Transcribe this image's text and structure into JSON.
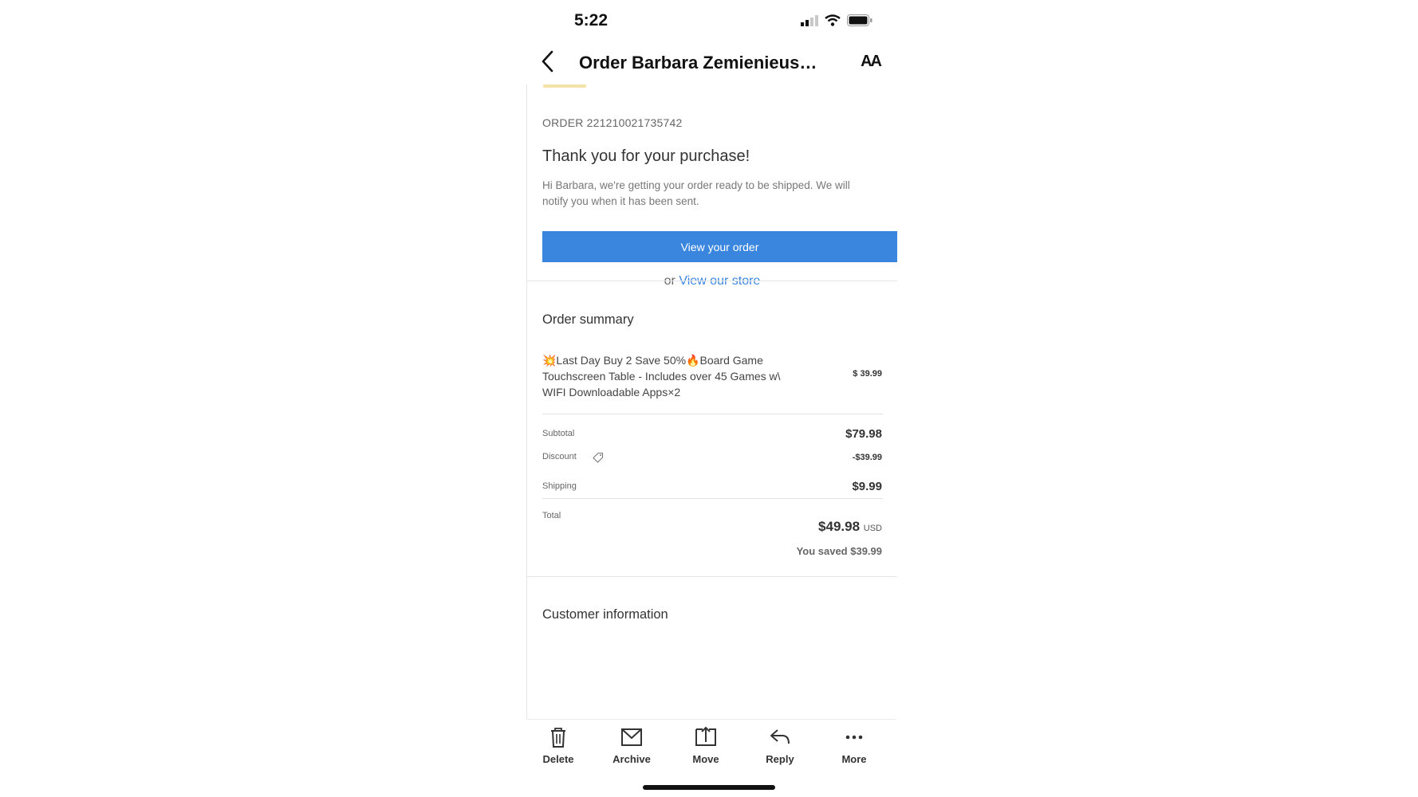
{
  "status_bar": {
    "time": "5:22"
  },
  "nav": {
    "title": "Order Barbara Zemienieuski c...",
    "back_icon": "chevron-left-icon",
    "text_size_label": "AA"
  },
  "email": {
    "order_number": "ORDER 221210021735742",
    "thank_you": "Thank you for your purchase!",
    "intro": "Hi Barbara, we're getting your order ready to be shipped. We will notify you when it has been sent.",
    "view_order_button": "View your order",
    "store_prefix": "or",
    "store_link": "View our store",
    "accent_color": "#3a86df"
  },
  "order_summary": {
    "heading": "Order summary",
    "item": {
      "title": "💥Last Day Buy 2 Save 50%🔥Board Game Touchscreen Table - Includes over 45 Games w\\ WIFI Downloadable Apps×2",
      "price": "$ 39.99"
    },
    "subtotal_label": "Subtotal",
    "subtotal_value": "$79.98",
    "discount_label": "Discount",
    "discount_value": "-$39.99",
    "shipping_label": "Shipping",
    "shipping_value": "$9.99",
    "total_label": "Total",
    "total_value": "$49.98",
    "total_currency": "USD",
    "saved_text": "You saved $39.99"
  },
  "customer_info": {
    "heading": "Customer information"
  },
  "toolbar": {
    "delete": "Delete",
    "archive": "Archive",
    "move": "Move",
    "reply": "Reply",
    "more": "More"
  }
}
